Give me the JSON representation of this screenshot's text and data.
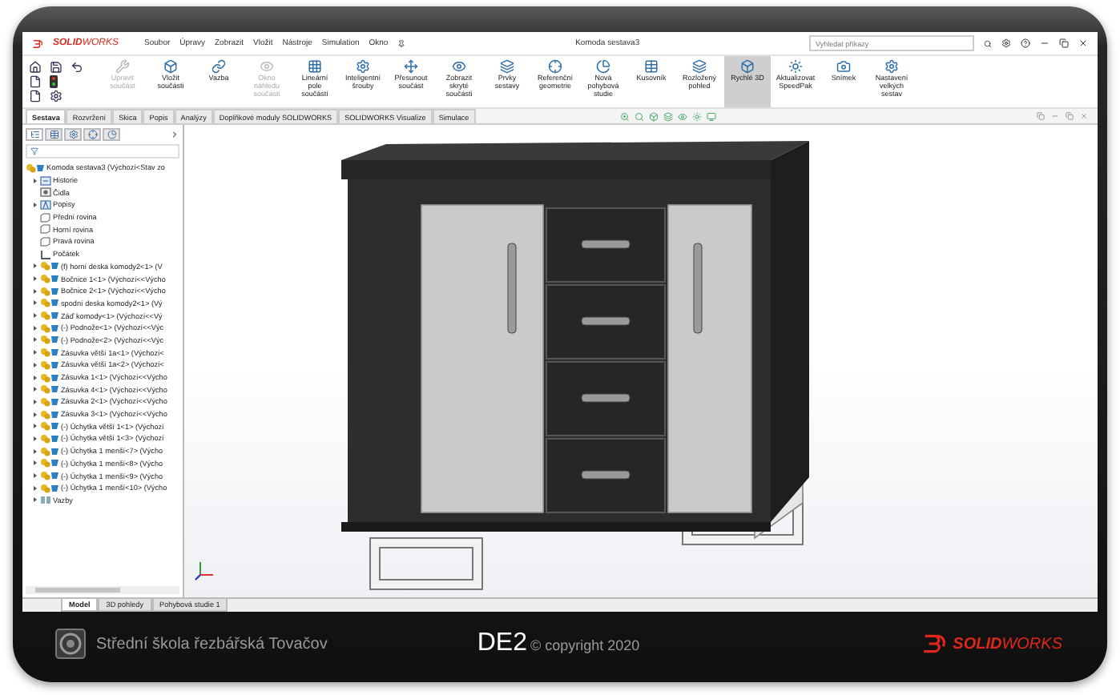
{
  "app": {
    "logo": "**SOLID**WORKS",
    "menu": [
      "Soubor",
      "Úpravy",
      "Zobrazit",
      "Vložit",
      "Nástroje",
      "Simulation",
      "Okno"
    ],
    "title": "Komoda sestava3",
    "search": {
      "placeholder": "Vyhledat příkazy"
    }
  },
  "ribbon": [
    {
      "label": "Upravit součást",
      "disabled": true,
      "selected": false
    },
    {
      "label": "Vložit součásti",
      "disabled": false,
      "selected": false
    },
    {
      "label": "Vazba",
      "disabled": false,
      "selected": false
    },
    {
      "label": "Okno náhledu součásti",
      "disabled": true,
      "selected": false
    },
    {
      "label": "Lineární pole součástí",
      "disabled": false,
      "selected": false
    },
    {
      "label": "Inteligentní šrouby",
      "disabled": false,
      "selected": false
    },
    {
      "label": "Přesunout součást",
      "disabled": false,
      "selected": false
    },
    {
      "label": "Zobrazit skryté součásti",
      "disabled": false,
      "selected": false
    },
    {
      "label": "Prvky sestavy",
      "disabled": false,
      "selected": false
    },
    {
      "label": "Referenční geometrie",
      "disabled": false,
      "selected": false
    },
    {
      "label": "Nová pohybová studie",
      "disabled": false,
      "selected": false
    },
    {
      "label": "Kusovník",
      "disabled": false,
      "selected": false
    },
    {
      "label": "Rozložený pohled",
      "disabled": false,
      "selected": false
    },
    {
      "label": "Rychlé 3D",
      "disabled": false,
      "selected": true
    },
    {
      "label": "Aktualizovat SpeedPak",
      "disabled": false,
      "selected": false
    },
    {
      "label": "Snímek",
      "disabled": false,
      "selected": false
    },
    {
      "label": "Nastavení velkých sestav",
      "disabled": false,
      "selected": false
    }
  ],
  "tabs": [
    {
      "label": "Sestava",
      "selected": true
    },
    {
      "label": "Rozvržení",
      "selected": false
    },
    {
      "label": "Skica",
      "selected": false
    },
    {
      "label": "Popis",
      "selected": false
    },
    {
      "label": "Analýzy",
      "selected": false
    },
    {
      "label": "Doplňkové moduly SOLIDWORKS",
      "selected": false
    },
    {
      "label": "SOLIDWORKS Visualize",
      "selected": false
    },
    {
      "label": "Simulace",
      "selected": false
    }
  ],
  "panel_tabs": [
    {
      "selected": true
    },
    {
      "selected": false
    },
    {
      "selected": false
    },
    {
      "selected": false
    },
    {
      "selected": false
    }
  ],
  "tree": {
    "root": "Komoda sestava3 (Výchozí<Stav zo",
    "items": [
      {
        "label": "Historie",
        "kind": "history",
        "expandable": true
      },
      {
        "label": "Čidla",
        "kind": "sensor",
        "expandable": false
      },
      {
        "label": "Popisy",
        "kind": "annotation",
        "expandable": true
      },
      {
        "label": "Přední rovina",
        "kind": "plane",
        "expandable": false
      },
      {
        "label": "Horní rovina",
        "kind": "plane",
        "expandable": false
      },
      {
        "label": "Pravá rovina",
        "kind": "plane",
        "expandable": false
      },
      {
        "label": "Počátek",
        "kind": "origin",
        "expandable": false
      },
      {
        "label": "(f) horní deska komody2<1> (V",
        "kind": "component",
        "expandable": true
      },
      {
        "label": "Bočnice 1<1> (Výchozí<<Výcho",
        "kind": "component",
        "expandable": true
      },
      {
        "label": "Bočnice 2<1> (Výchozí<<Výcho",
        "kind": "component",
        "expandable": true
      },
      {
        "label": "spodní deska komody2<1> (Vý",
        "kind": "component",
        "expandable": true
      },
      {
        "label": "Záď komody<1> (Výchozí<<Vý",
        "kind": "component",
        "expandable": true
      },
      {
        "label": "(-) Podnože<1> (Výchozí<<Výc",
        "kind": "component",
        "expandable": true
      },
      {
        "label": "(-) Podnože<2> (Výchozí<<Výc",
        "kind": "component",
        "expandable": true
      },
      {
        "label": "Zásuvka větší 1a<1> (Výchozí<",
        "kind": "component",
        "expandable": true
      },
      {
        "label": "Zásuvka větší 1a<2> (Výchozí<",
        "kind": "component",
        "expandable": true
      },
      {
        "label": "Zásuvka 1<1> (Výchozí<<Výcho",
        "kind": "component",
        "expandable": true
      },
      {
        "label": "Zásuvka 4<1> (Výchozí<<Výcho",
        "kind": "component",
        "expandable": true
      },
      {
        "label": "Zásuvka 2<1> (Výchozí<<Výcho",
        "kind": "component",
        "expandable": true
      },
      {
        "label": "Zásuvka 3<1> (Výchozí<<Výcho",
        "kind": "component",
        "expandable": true
      },
      {
        "label": "(-) Úchytka větší 1<1> (Výchozí",
        "kind": "component",
        "expandable": true
      },
      {
        "label": "(-) Úchytka větší 1<3> (Výchozí",
        "kind": "component",
        "expandable": true
      },
      {
        "label": "(-) Úchytka 1 menší<7> (Výcho",
        "kind": "component",
        "expandable": true
      },
      {
        "label": "(-) Úchytka 1 menší<8> (Výcho",
        "kind": "component",
        "expandable": true
      },
      {
        "label": "(-) Úchytka 1 menší<9> (Výcho",
        "kind": "component",
        "expandable": true
      },
      {
        "label": "(-) Úchytka 1 menší<10> (Výcho",
        "kind": "component",
        "expandable": true
      },
      {
        "label": "Vazby",
        "kind": "mates",
        "expandable": true
      }
    ]
  },
  "model_tabs": [
    {
      "label": "Model",
      "selected": true
    },
    {
      "label": "3D pohledy",
      "selected": false
    },
    {
      "label": "Pohybová studie 1",
      "selected": false
    }
  ],
  "footer": {
    "school": "Střední škola řezbářská Tovačov",
    "code": "DE2",
    "copyright": "© copyright 2020",
    "brand": "**SOLID**WORKS"
  }
}
